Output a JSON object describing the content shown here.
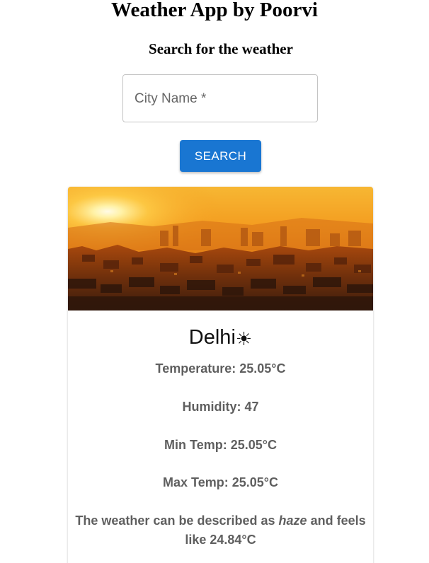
{
  "header": {
    "title": "Weather App by Poorvi",
    "subtitle": "Search for the weather"
  },
  "search": {
    "label": "City Name *",
    "value": "",
    "button_label": "SEARCH"
  },
  "card": {
    "image_description": "sunset-over-city",
    "city": "Delhi",
    "condition_icon": "sun-icon",
    "temperature": "Temperature: 25.05°C",
    "humidity": "Humidity: 47",
    "min_temp": "Min Temp: 25.05°C",
    "max_temp": "Max Temp: 25.05°C",
    "description_prefix": "The weather can be described as",
    "description_word": "haze",
    "description_suffix": "and feels like 24.84°C"
  },
  "colors": {
    "button": "#1976d2",
    "text_secondary": "#5f5f5f"
  }
}
